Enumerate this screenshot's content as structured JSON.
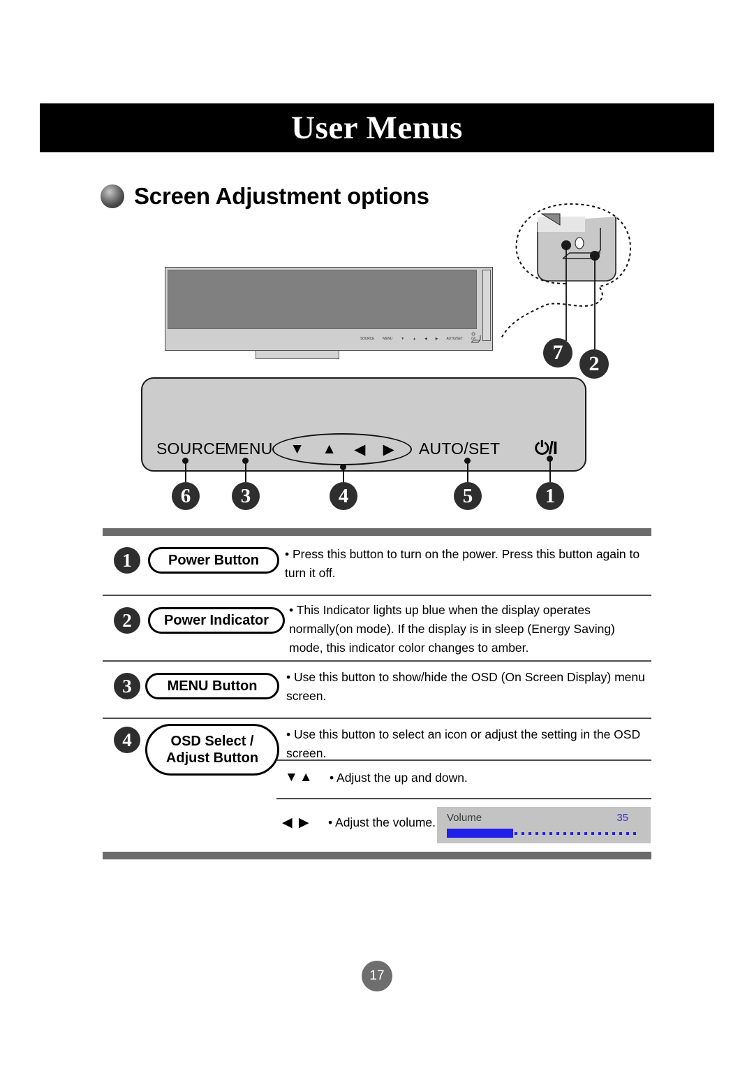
{
  "page": {
    "banner_title": "User Menus",
    "section_heading": "Screen Adjustment options",
    "page_number": "17"
  },
  "monitor": {
    "bezel_controls": [
      "SOURCE",
      "MENU",
      "▼",
      "▲",
      "◀",
      "▶",
      "AUTO/SET",
      "⏻/I"
    ],
    "callout_numbers": [
      "7",
      "2"
    ]
  },
  "control_panel": {
    "buttons": [
      {
        "label": "SOURCE",
        "number": "6"
      },
      {
        "label": "MENU",
        "number": "3"
      },
      {
        "label": "AUTO/SET",
        "number": "5"
      },
      {
        "label": "⏻/I",
        "number": "1"
      }
    ],
    "arrow_group": {
      "number": "4",
      "arrows": [
        "▼",
        "▲",
        "◀",
        "▶"
      ]
    }
  },
  "table": {
    "rows": [
      {
        "number": "1",
        "name": "Power Button",
        "description": "• Press this button to turn on the power. Press this button again to turn it off."
      },
      {
        "number": "2",
        "name": "Power Indicator",
        "description": "• This Indicator lights up blue when the display operates normally(on mode). If the display is in sleep (Energy Saving) mode, this indicator color changes to amber."
      },
      {
        "number": "3",
        "name": "MENU Button",
        "description": "• Use this button to show/hide the OSD (On Screen Display) menu screen."
      },
      {
        "number": "4",
        "name_line1": "OSD Select /",
        "name_line2": "Adjust Button",
        "description": "•  Use this button to select an icon or adjust the setting in the OSD screen.",
        "sub_rows": [
          {
            "arrows": "▼▲",
            "text": "• Adjust the up and down."
          },
          {
            "arrows": "◀ ▶",
            "text": "• Adjust the volume."
          }
        ]
      }
    ]
  },
  "volume_osd": {
    "label": "Volume",
    "value": "35",
    "fill_percent": 35
  },
  "colors": {
    "banner_bg": "#000000",
    "rule_gray": "#6b6b6b",
    "screen_gray": "#808080",
    "bezel_gray": "#cfcfcf",
    "panel_gray": "#cccccc",
    "osd_bg": "#c3c3c3",
    "osd_blue": "#2020e8",
    "number_circle": "#2e2e2e",
    "page_circle": "#6e6e6e"
  }
}
